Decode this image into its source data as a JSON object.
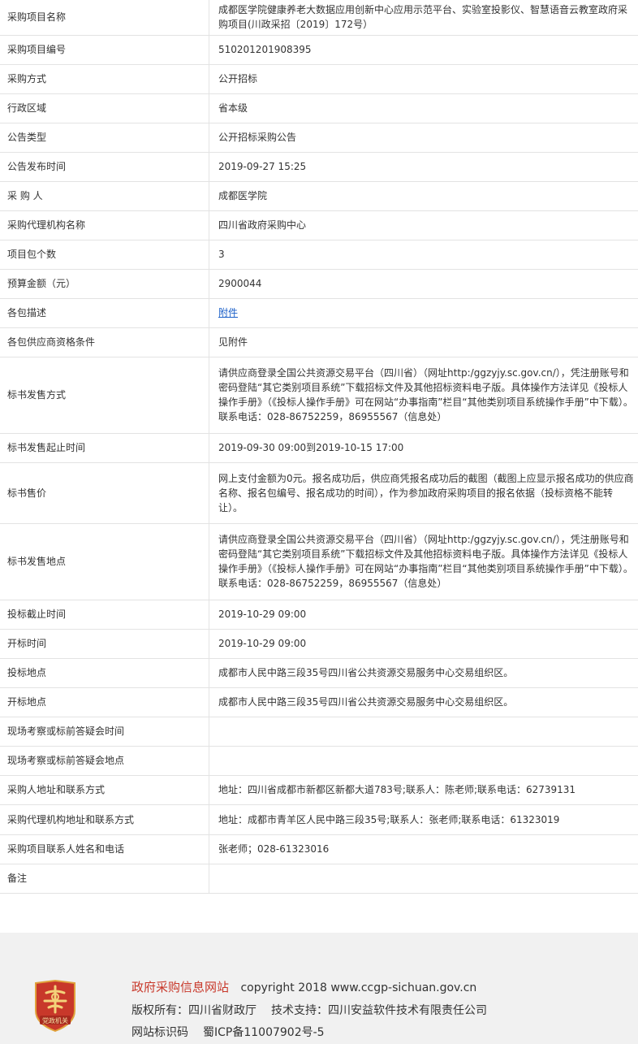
{
  "rows": [
    {
      "label": "采购项目名称",
      "value": "成都医学院健康养老大数据应用创新中心应用示范平台、实验室投影仪、智慧语音云教室政府采购项目(川政采招〔2019〕172号）"
    },
    {
      "label": "采购项目编号",
      "value": "510201201908395"
    },
    {
      "label": "采购方式",
      "value": "公开招标"
    },
    {
      "label": "行政区域",
      "value": "省本级"
    },
    {
      "label": "公告类型",
      "value": "公开招标采购公告"
    },
    {
      "label": "公告发布时间",
      "value": "2019-09-27 15:25"
    },
    {
      "label": "采 购 人",
      "value": "成都医学院"
    },
    {
      "label": "采购代理机构名称",
      "value": "四川省政府采购中心"
    },
    {
      "label": "项目包个数",
      "value": "3"
    },
    {
      "label": "预算金额（元）",
      "value": "2900044"
    },
    {
      "label": "各包描述",
      "value": "附件",
      "link": true
    },
    {
      "label": "各包供应商资格条件",
      "value": "见附件"
    },
    {
      "label": "标书发售方式",
      "value": "请供应商登录全国公共资源交易平台（四川省）（网址http:/ggzyjy.sc.gov.cn/），凭注册账号和密码登陆“其它类别项目系统”下载招标文件及其他招标资料电子版。具体操作方法详见《投标人操作手册》（《投标人操作手册》可在网站“办事指南”栏目“其他类别项目系统操作手册”中下载）。联系电话：028-86752259，86955567（信息处）"
    },
    {
      "label": "标书发售起止时间",
      "value": "2019-09-30 09:00到2019-10-15 17:00"
    },
    {
      "label": "标书售价",
      "value": "网上支付金额为0元。报名成功后，供应商凭报名成功后的截图（截图上应显示报名成功的供应商名称、报名包编号、报名成功的时间），作为参加政府采购项目的报名依据（投标资格不能转让）。"
    },
    {
      "label": "标书发售地点",
      "value": "请供应商登录全国公共资源交易平台（四川省）（网址http:/ggzyjy.sc.gov.cn/），凭注册账号和密码登陆“其它类别项目系统”下载招标文件及其他招标资料电子版。具体操作方法详见《投标人操作手册》（《投标人操作手册》可在网站“办事指南”栏目“其他类别项目系统操作手册”中下载）。联系电话：028-86752259，86955567（信息处）"
    },
    {
      "label": "投标截止时间",
      "value": "2019-10-29 09:00"
    },
    {
      "label": "开标时间",
      "value": "2019-10-29 09:00"
    },
    {
      "label": "投标地点",
      "value": "成都市人民中路三段35号四川省公共资源交易服务中心交易组织区。"
    },
    {
      "label": "开标地点",
      "value": "成都市人民中路三段35号四川省公共资源交易服务中心交易组织区。"
    },
    {
      "label": "现场考察或标前答疑会时间",
      "value": ""
    },
    {
      "label": "现场考察或标前答疑会地点",
      "value": ""
    },
    {
      "label": "采购人地址和联系方式",
      "value": "地址：四川省成都市新都区新都大道783号;联系人：陈老师;联系电话：62739131"
    },
    {
      "label": "采购代理机构地址和联系方式",
      "value": "地址：成都市青羊区人民中路三段35号;联系人：张老师;联系电话：61323019"
    },
    {
      "label": "采购项目联系人姓名和电话",
      "value": "张老师；028-61323016"
    },
    {
      "label": "备注",
      "value": ""
    }
  ],
  "footer": {
    "site_name": "政府采购信息网站",
    "copyright": "copyright 2018 www.ccgp-sichuan.gov.cn",
    "owner": "版权所有：四川省财政厅",
    "tech_support": "技术支持：四川安益软件技术有限责任公司",
    "site_code_label": "网站标识码",
    "icp": "蜀ICP备11007902号-5",
    "badge_text": "党政机关",
    "badge_icon": "party-government-badge-icon",
    "badge_color": "#c8382a"
  }
}
